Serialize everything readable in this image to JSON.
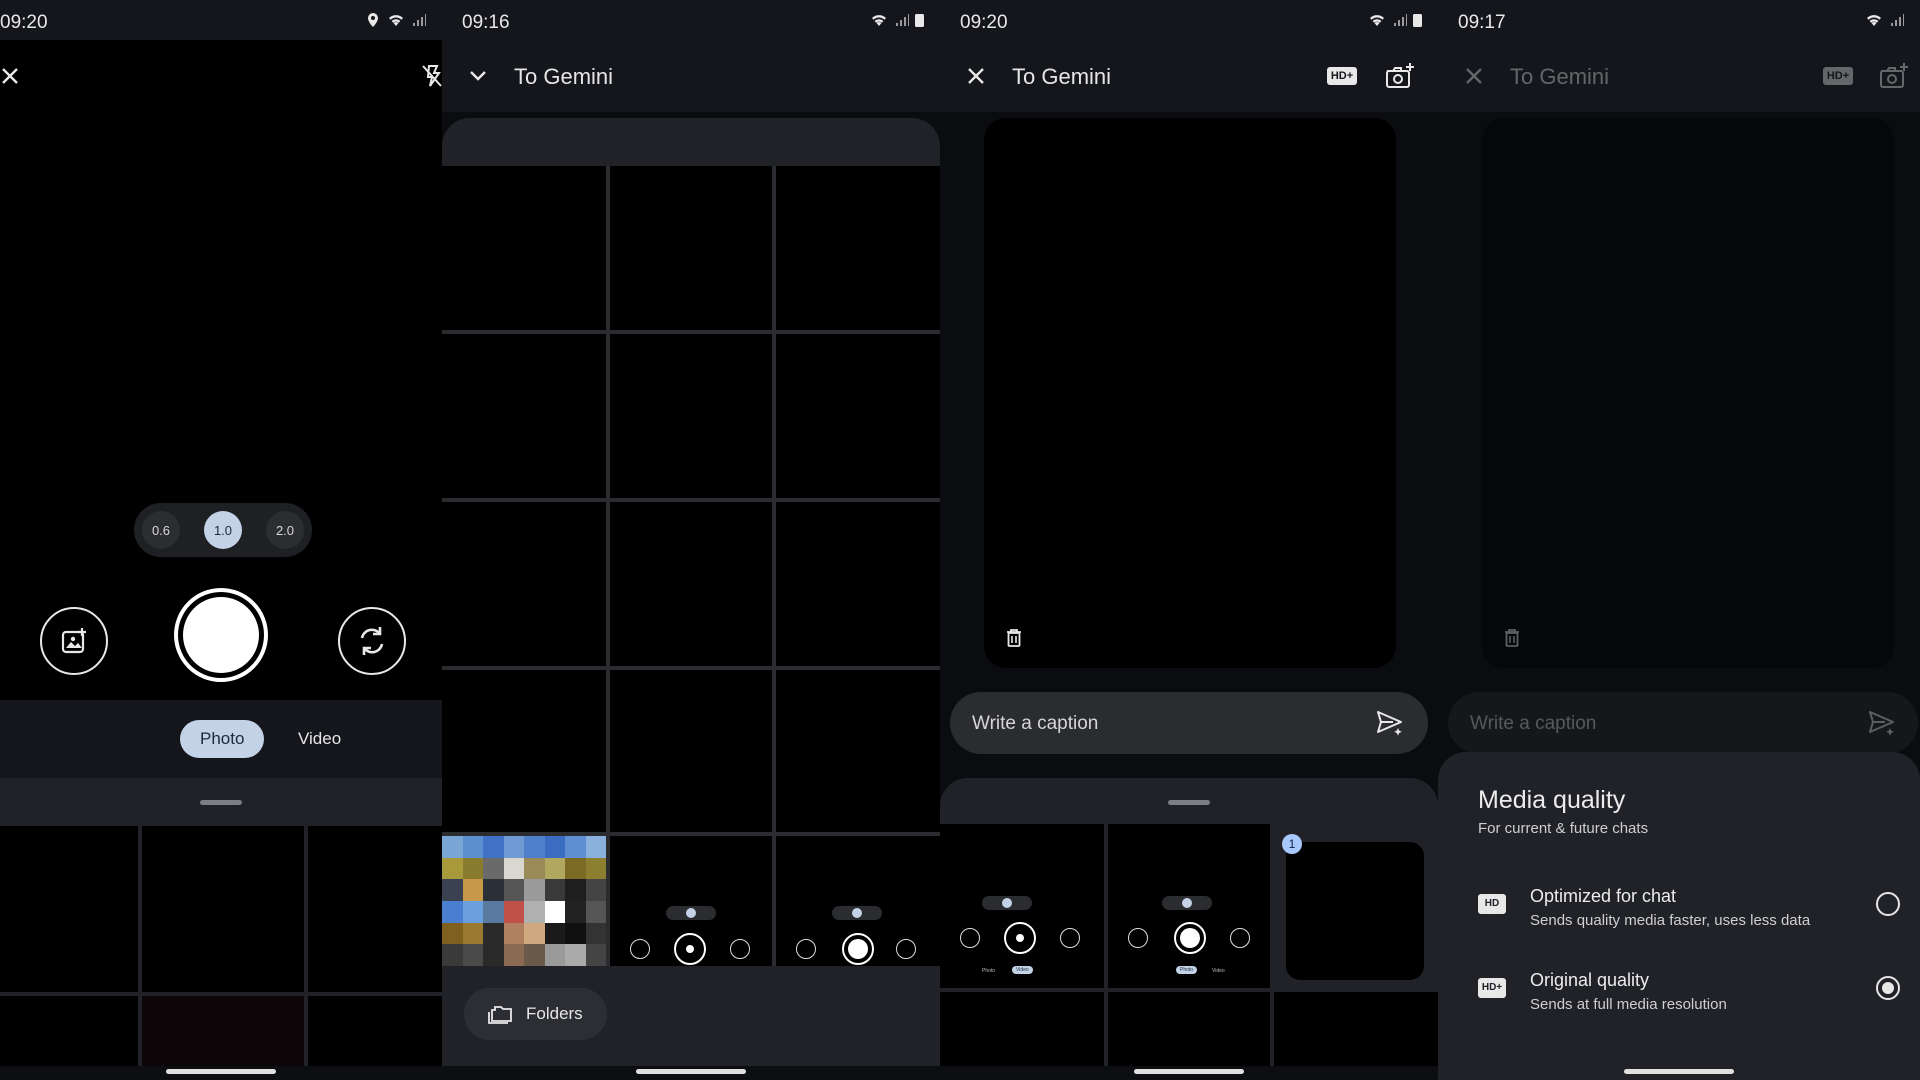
{
  "panels": {
    "camera": {
      "time": "09:20",
      "zoom_levels": [
        "0.6",
        "1.0",
        "2.0"
      ],
      "active_zoom": "1.0",
      "modes": {
        "photo": "Photo",
        "video": "Video"
      }
    },
    "gallery": {
      "time": "09:16",
      "title": "To Gemini",
      "folders_label": "Folders"
    },
    "preview": {
      "time": "09:20",
      "title": "To Gemini",
      "hd_badge": "HD+",
      "caption_placeholder": "Write a caption",
      "selection_count": "1",
      "mini_modes": {
        "photo": "Photo",
        "video": "Video"
      }
    },
    "media_quality": {
      "time": "09:17",
      "title": "To Gemini",
      "hd_badge": "HD+",
      "caption_placeholder": "Write a caption",
      "sheet_title": "Media quality",
      "sheet_subtitle": "For current & future chats",
      "options": [
        {
          "badge": "HD",
          "label": "Optimized for chat",
          "description": "Sends quality media faster, uses less data",
          "selected": false
        },
        {
          "badge": "HD+",
          "label": "Original quality",
          "description": "Sends at full media resolution",
          "selected": true
        }
      ]
    }
  },
  "colors": {
    "background": "#0b0c0f",
    "surface": "#202227",
    "accent_pill": "#c4d2e8",
    "badge_blue": "#a8c7fa"
  }
}
